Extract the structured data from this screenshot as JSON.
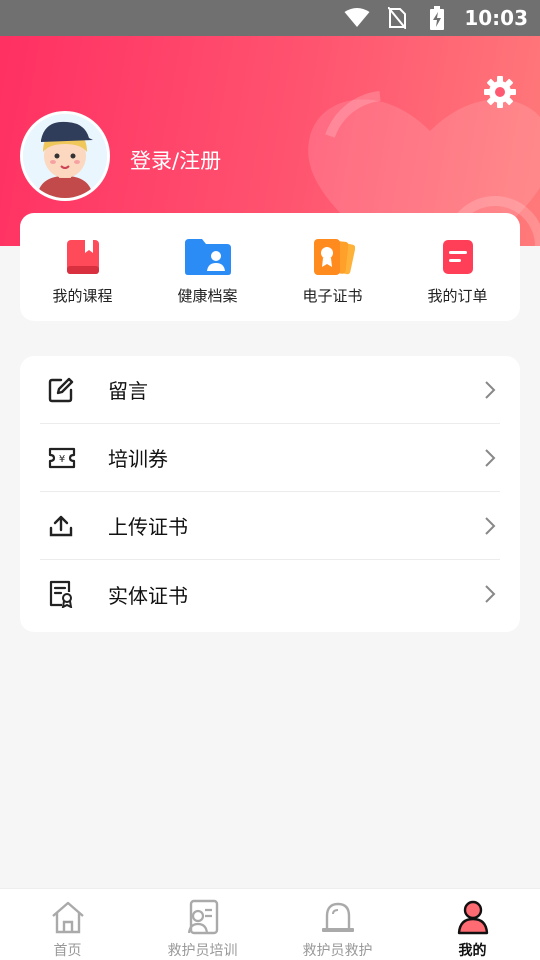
{
  "status_bar": {
    "time": "10:03",
    "icons": [
      "wifi-icon",
      "no-sim-icon",
      "battery-charging-icon"
    ]
  },
  "header": {
    "login_label": "登录/注册",
    "settings_icon": "gear-icon",
    "accent_start": "#ff3062",
    "accent_end": "#ff7a7a"
  },
  "quick_actions": [
    {
      "label": "我的课程",
      "icon": "course-book-icon"
    },
    {
      "label": "健康档案",
      "icon": "health-folder-icon"
    },
    {
      "label": "电子证书",
      "icon": "e-certificate-icon"
    },
    {
      "label": "我的订单",
      "icon": "order-icon"
    }
  ],
  "menu": [
    {
      "label": "留言",
      "icon": "edit-message-icon"
    },
    {
      "label": "培训券",
      "icon": "voucher-icon"
    },
    {
      "label": "上传证书",
      "icon": "upload-icon"
    },
    {
      "label": "实体证书",
      "icon": "certificate-document-icon"
    }
  ],
  "tabs": [
    {
      "label": "首页",
      "icon": "home-icon",
      "active": false
    },
    {
      "label": "救护员培训",
      "icon": "training-icon",
      "active": false
    },
    {
      "label": "救护员救护",
      "icon": "alarm-light-icon",
      "active": false
    },
    {
      "label": "我的",
      "icon": "person-icon",
      "active": true
    }
  ]
}
